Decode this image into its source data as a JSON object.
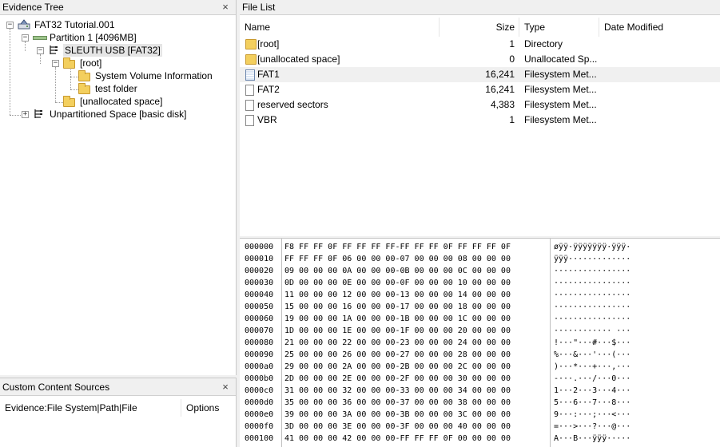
{
  "evidence_tree": {
    "title": "Evidence Tree",
    "nodes": [
      {
        "label": "FAT32 Tutorial.001",
        "icon": "disk-image-icon",
        "expander": "−"
      },
      {
        "label": "Partition 1 [4096MB]",
        "icon": "partition-icon",
        "expander": "−"
      },
      {
        "label": "SLEUTH USB [FAT32]",
        "icon": "filesystem-icon",
        "expander": "−"
      },
      {
        "label": "[root]",
        "icon": "folder-icon",
        "expander": "−"
      },
      {
        "label": "System Volume Information",
        "icon": "folder-icon"
      },
      {
        "label": "test folder",
        "icon": "folder-icon"
      },
      {
        "label": "[unallocated space]",
        "icon": "folder-icon"
      },
      {
        "label": "Unpartitioned Space [basic disk]",
        "icon": "filesystem-icon",
        "expander": "+"
      }
    ]
  },
  "file_list": {
    "title": "File List",
    "columns": [
      "Name",
      "Size",
      "Type",
      "Date Modified"
    ],
    "rows": [
      {
        "name": "[root]",
        "size": "1",
        "type": "Directory",
        "date": "",
        "icon": "folder-icon"
      },
      {
        "name": "[unallocated space]",
        "size": "0",
        "type": "Unallocated Sp...",
        "date": "",
        "icon": "folder-icon"
      },
      {
        "name": "FAT1",
        "size": "16,241",
        "type": "Filesystem Met...",
        "date": "",
        "icon": "fat-table-icon",
        "selected": true
      },
      {
        "name": "FAT2",
        "size": "16,241",
        "type": "Filesystem Met...",
        "date": "",
        "icon": "file-icon"
      },
      {
        "name": "reserved sectors",
        "size": "4,383",
        "type": "Filesystem Met...",
        "date": "",
        "icon": "file-icon"
      },
      {
        "name": "VBR",
        "size": "1",
        "type": "Filesystem Met...",
        "date": "",
        "icon": "file-icon"
      }
    ]
  },
  "hex_view": {
    "rows": [
      {
        "off": "000000",
        "bytes": "F8 FF FF 0F FF FF FF FF-FF FF FF 0F FF FF FF 0F",
        "ascii": "øÿÿ·ÿÿÿÿÿÿÿ·ÿÿÿ·"
      },
      {
        "off": "000010",
        "bytes": "FF FF FF 0F 06 00 00 00-07 00 00 00 08 00 00 00",
        "ascii": "ÿÿÿ·············"
      },
      {
        "off": "000020",
        "bytes": "09 00 00 00 0A 00 00 00-0B 00 00 00 0C 00 00 00",
        "ascii": "················"
      },
      {
        "off": "000030",
        "bytes": "0D 00 00 00 0E 00 00 00-0F 00 00 00 10 00 00 00",
        "ascii": "················"
      },
      {
        "off": "000040",
        "bytes": "11 00 00 00 12 00 00 00-13 00 00 00 14 00 00 00",
        "ascii": "················"
      },
      {
        "off": "000050",
        "bytes": "15 00 00 00 16 00 00 00-17 00 00 00 18 00 00 00",
        "ascii": "················"
      },
      {
        "off": "000060",
        "bytes": "19 00 00 00 1A 00 00 00-1B 00 00 00 1C 00 00 00",
        "ascii": "················"
      },
      {
        "off": "000070",
        "bytes": "1D 00 00 00 1E 00 00 00-1F 00 00 00 20 00 00 00",
        "ascii": "············ ···"
      },
      {
        "off": "000080",
        "bytes": "21 00 00 00 22 00 00 00-23 00 00 00 24 00 00 00",
        "ascii": "!···\"···#···$···"
      },
      {
        "off": "000090",
        "bytes": "25 00 00 00 26 00 00 00-27 00 00 00 28 00 00 00",
        "ascii": "%···&···'···(···"
      },
      {
        "off": "0000a0",
        "bytes": "29 00 00 00 2A 00 00 00-2B 00 00 00 2C 00 00 00",
        "ascii": ")···*···+···,···"
      },
      {
        "off": "0000b0",
        "bytes": "2D 00 00 00 2E 00 00 00-2F 00 00 00 30 00 00 00",
        "ascii": "-···.···/···0···"
      },
      {
        "off": "0000c0",
        "bytes": "31 00 00 00 32 00 00 00-33 00 00 00 34 00 00 00",
        "ascii": "1···2···3···4···"
      },
      {
        "off": "0000d0",
        "bytes": "35 00 00 00 36 00 00 00-37 00 00 00 38 00 00 00",
        "ascii": "5···6···7···8···"
      },
      {
        "off": "0000e0",
        "bytes": "39 00 00 00 3A 00 00 00-3B 00 00 00 3C 00 00 00",
        "ascii": "9···:···;···<···"
      },
      {
        "off": "0000f0",
        "bytes": "3D 00 00 00 3E 00 00 00-3F 00 00 00 40 00 00 00",
        "ascii": "=···>···?···@···"
      },
      {
        "off": "000100",
        "bytes": "41 00 00 00 42 00 00 00-FF FF FF 0F 00 00 00 00",
        "ascii": "A···B···ÿÿÿ·····"
      }
    ]
  },
  "custom_content_sources": {
    "title": "Custom Content Sources",
    "columns": [
      "Evidence:File System|Path|File",
      "Options"
    ]
  },
  "close_glyph": "×"
}
